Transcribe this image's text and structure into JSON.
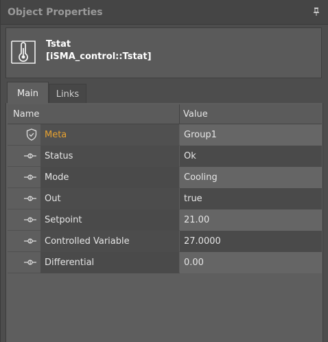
{
  "panel": {
    "title": "Object Properties"
  },
  "object": {
    "name": "Tstat",
    "type": "[iSMA_control::Tstat]"
  },
  "tabs": [
    {
      "label": "Main",
      "active": true
    },
    {
      "label": "Links",
      "active": false
    }
  ],
  "grid": {
    "columns": {
      "name": "Name",
      "value": "Value"
    },
    "rows": [
      {
        "name": "Meta",
        "value": "Group1",
        "icon": "shield-icon"
      },
      {
        "name": "Status",
        "value": "Ok",
        "icon": "slot-icon"
      },
      {
        "name": "Mode",
        "value": "Cooling",
        "icon": "slot-icon"
      },
      {
        "name": "Out",
        "value": "true",
        "icon": "slot-icon"
      },
      {
        "name": "Setpoint",
        "value": "21.00",
        "icon": "slot-icon"
      },
      {
        "name": "Controlled Variable",
        "value": "27.0000",
        "icon": "slot-icon"
      },
      {
        "name": "Differential",
        "value": "0.00",
        "icon": "slot-icon"
      }
    ]
  },
  "colors": {
    "meta_label": "#e8a230",
    "background": "#4d4d4d"
  }
}
